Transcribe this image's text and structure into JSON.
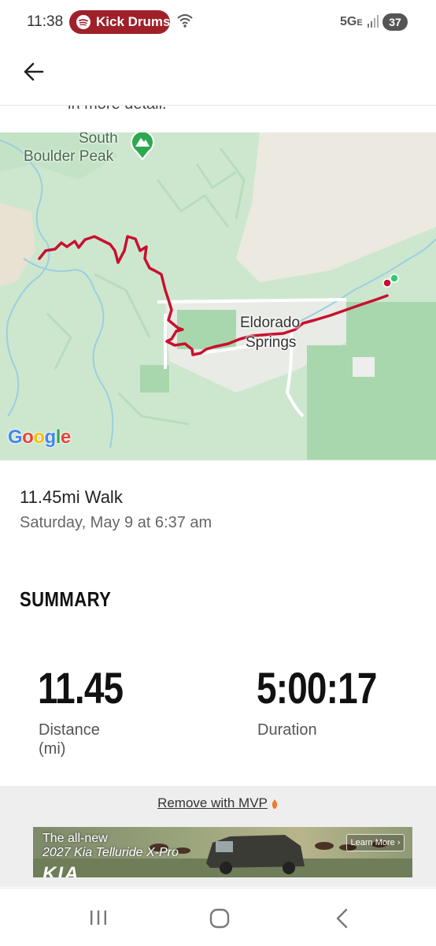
{
  "status_bar": {
    "time": "11:38",
    "now_playing": "Kick Drums",
    "network": "5G",
    "network_suffix": "E",
    "battery": "37"
  },
  "app_bar": {
    "back_icon": "arrow-left-icon",
    "cutoff_text": "in more detail."
  },
  "map": {
    "peak_label_line1": "South",
    "peak_label_line2": "Boulder Peak",
    "town_label_line1": "Eldorado",
    "town_label_line2": "Springs",
    "provider": "Google",
    "route_color": "#c8102e",
    "start_marker_color": "#2ecc71",
    "end_marker_color": "#c8102e"
  },
  "activity": {
    "title": "11.45mi Walk",
    "date": "Saturday, May 9 at 6:37 am"
  },
  "summary": {
    "heading": "SUMMARY",
    "stats": [
      {
        "value": "11.45",
        "label_line1": "Distance",
        "label_line2": "(mi)"
      },
      {
        "value": "5:00:17",
        "label_line1": "Duration",
        "label_line2": ""
      }
    ]
  },
  "ad": {
    "remove_label": "Remove with MVP",
    "line1": "The all-new",
    "line2": "2027 Kia Telluride X-Pro",
    "cta": "Learn More",
    "brand": "KIA"
  },
  "nav": {
    "recents_icon": "recents-icon",
    "home_icon": "home-icon",
    "back_icon": "nav-back-icon"
  }
}
